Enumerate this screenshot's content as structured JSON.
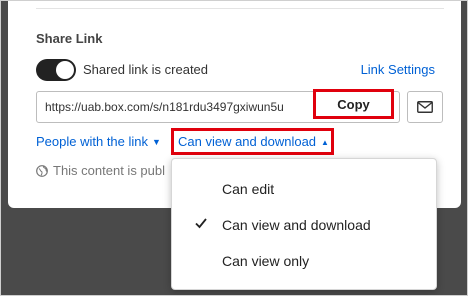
{
  "share": {
    "section_title": "Share Link",
    "toggle_label": "Shared link is created",
    "link_settings_label": "Link Settings",
    "url_value": "https://uab.box.com/s/n181rdu3497gxiwun5u",
    "copy_label": "Copy",
    "people_label": "People with the link",
    "access_label": "Can view and download",
    "info_text": "This content is publ"
  },
  "dropdown": {
    "items": [
      {
        "label": "Can edit",
        "selected": false
      },
      {
        "label": "Can view and download",
        "selected": true
      },
      {
        "label": "Can view only",
        "selected": false
      }
    ]
  },
  "colors": {
    "link": "#0061d5",
    "highlight": "#e0000d",
    "backdrop": "#4a4a4a"
  },
  "icons": {
    "mail": "envelope-icon",
    "globe": "globe-icon",
    "check": "checkmark-icon"
  }
}
